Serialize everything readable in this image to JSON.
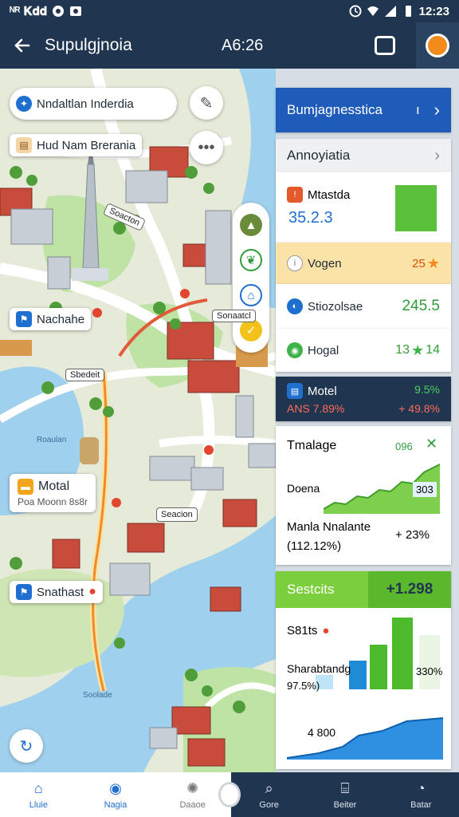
{
  "status_bar": {
    "left_text": "ᴺᴿ 𝐊𝐝𝐝",
    "time": "12:23"
  },
  "app_bar": {
    "title": "Supulgjnoia",
    "center_text": "A6:26"
  },
  "map": {
    "labels": {
      "top_search": "Nndaltlan Inderdia",
      "hotel": "Hud Nam Brerania",
      "nachahe": "Nachahe",
      "sbedeit": "Sbedeit",
      "motal": "Motal",
      "motal_sub": "Poa Moonn 8s8r",
      "snathast": "Snathast",
      "sonaatcl": "Sonaatcl",
      "soacton": "Soacton",
      "seacion": "Seacion",
      "roaulan": "Roaulan",
      "soolade": "Soolade"
    }
  },
  "panel": {
    "header": "Bumjagnesstica",
    "header_count": "ı",
    "section1": {
      "title": "Annoyiatia",
      "item_title": "Mtastda",
      "item_value": "35.2.3"
    },
    "row_vogen": {
      "label": "Vogen",
      "value": "25"
    },
    "row_stio": {
      "label": "Stiozolsae",
      "value": "245.5"
    },
    "row_hogal": {
      "label": "Hogal",
      "value": "13",
      "value2": "14"
    },
    "motel": {
      "label": "Motel",
      "value_a": "9.5%",
      "value_b": "ANS 7.89%",
      "value_c": "+ 49.8%"
    },
    "trend": {
      "title": "Tmalage",
      "top_value": "096",
      "mid_label": "Doena",
      "mid_value": "303",
      "row_label": "Manla Nnalante",
      "row_sub": "(112.12%)",
      "row_value": "+ 23%"
    },
    "stats": {
      "header": "Sestcits",
      "header_value": "+1.298",
      "label1": "S81ts",
      "value1": "330%",
      "label2": "Sharabtandg",
      "sub2": "97.5%)",
      "label3": "4 800"
    }
  },
  "bottom_nav": {
    "left": [
      {
        "label": "Lluie"
      },
      {
        "label": "Nagia"
      },
      {
        "label": "Daaoe"
      }
    ],
    "right": [
      {
        "label": "Gore"
      },
      {
        "label": "Beiter"
      },
      {
        "label": "Batar"
      }
    ]
  },
  "colors": {
    "dark_bar": "#1f3550",
    "accent_blue": "#1f6fd1",
    "accent_green": "#3fb24a",
    "water": "#9fd0ee"
  }
}
